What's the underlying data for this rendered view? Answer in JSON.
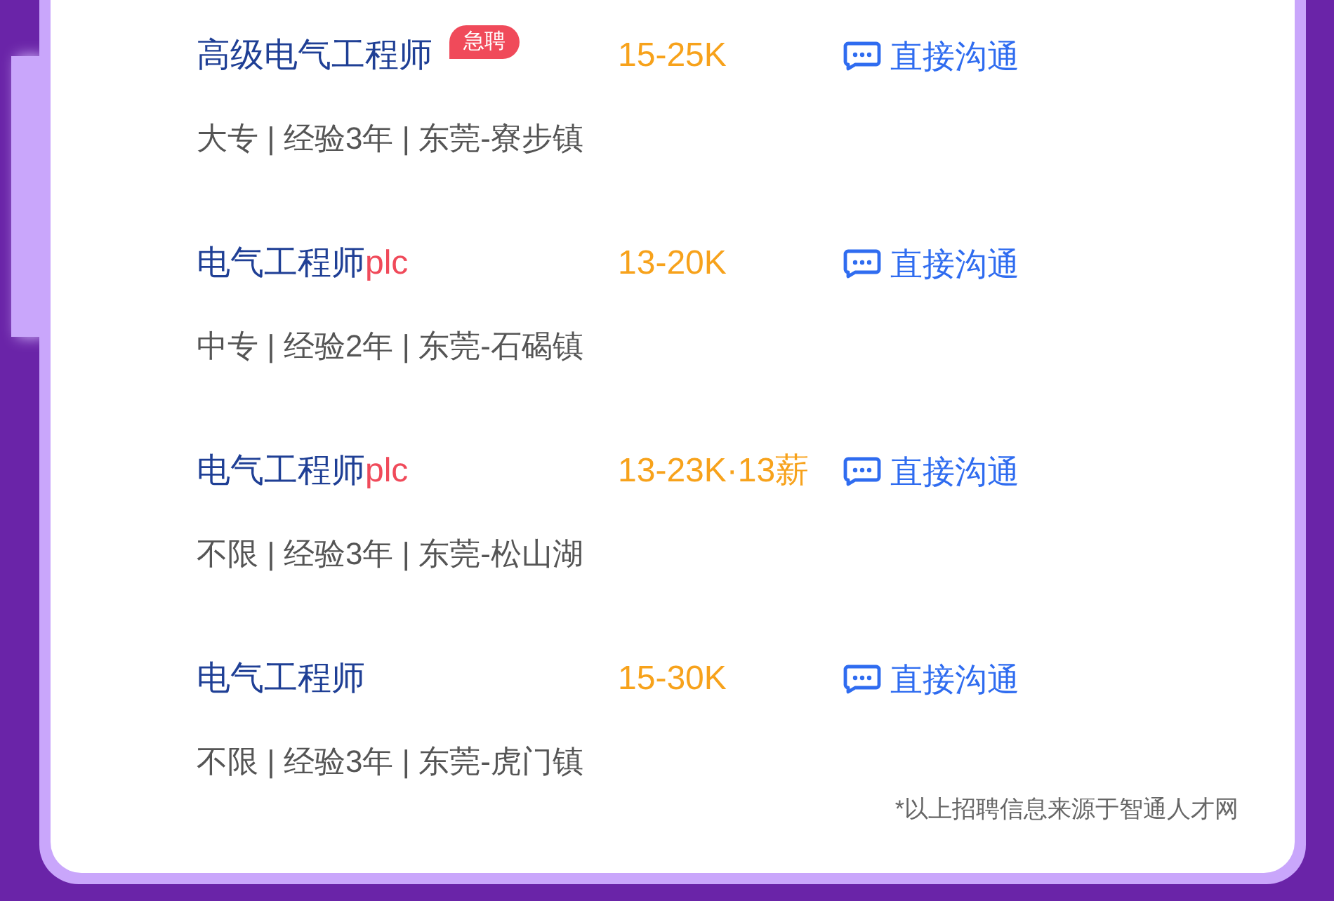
{
  "jobs": [
    {
      "title": "高级电气工程师",
      "badge": "急聘",
      "salary": "15-25K",
      "action": "直接沟通",
      "meta": "大专 | 经验3年 | 东莞-寮步镇"
    },
    {
      "title": "电气工程师",
      "suffix": "plc",
      "salary": "13-20K",
      "action": "直接沟通",
      "meta": "中专 | 经验2年 | 东莞-石碣镇"
    },
    {
      "title": "电气工程师",
      "suffix": "plc",
      "salary": "13-23K·13薪",
      "action": "直接沟通",
      "meta": "不限 | 经验3年 | 东莞-松山湖"
    },
    {
      "title": "电气工程师",
      "salary": "15-30K",
      "action": "直接沟通",
      "meta": "不限 | 经验3年 | 东莞-虎门镇"
    }
  ],
  "source_note": "*以上招聘信息来源于智通人才网"
}
